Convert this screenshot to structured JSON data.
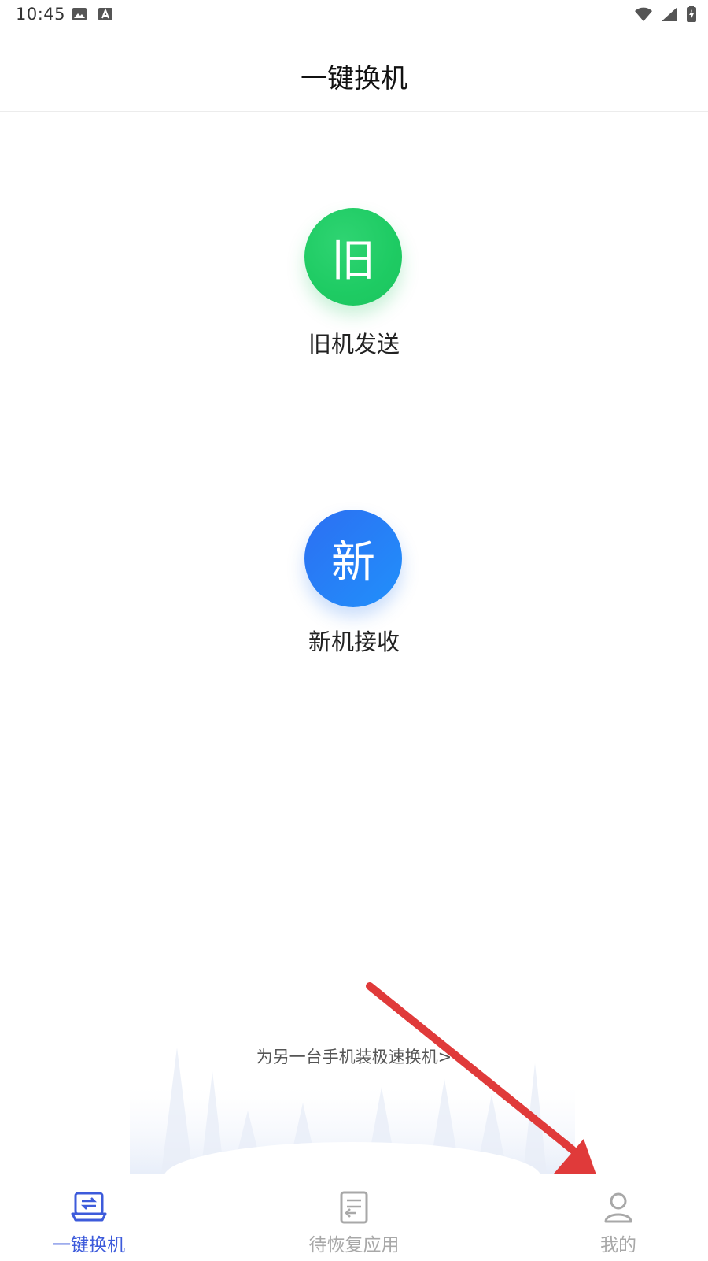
{
  "status_bar": {
    "time": "10:45",
    "icons_left": [
      "image-icon",
      "a-notification-icon"
    ],
    "icons_right": [
      "wifi-icon",
      "signal-icon",
      "battery-charging-icon"
    ]
  },
  "header": {
    "title": "一键换机"
  },
  "main": {
    "old_device": {
      "icon_text": "旧",
      "label": "旧机发送",
      "color": "#1ecb63"
    },
    "new_device": {
      "icon_text": "新",
      "label": "新机接收",
      "color": "#2a7ff6"
    },
    "promo_link": "为另一台手机装极速换机>"
  },
  "bottom_nav": {
    "items": [
      {
        "label": "一键换机",
        "icon": "phone-transfer-icon",
        "active": true
      },
      {
        "label": "待恢复应用",
        "icon": "restore-apps-icon",
        "active": false
      },
      {
        "label": "我的",
        "icon": "user-icon",
        "active": false
      }
    ],
    "active_color": "#3d5bdb",
    "inactive_color": "#a8a8a8"
  },
  "annotation": {
    "arrow_color": "#e03a3a",
    "points_to": "我的"
  }
}
